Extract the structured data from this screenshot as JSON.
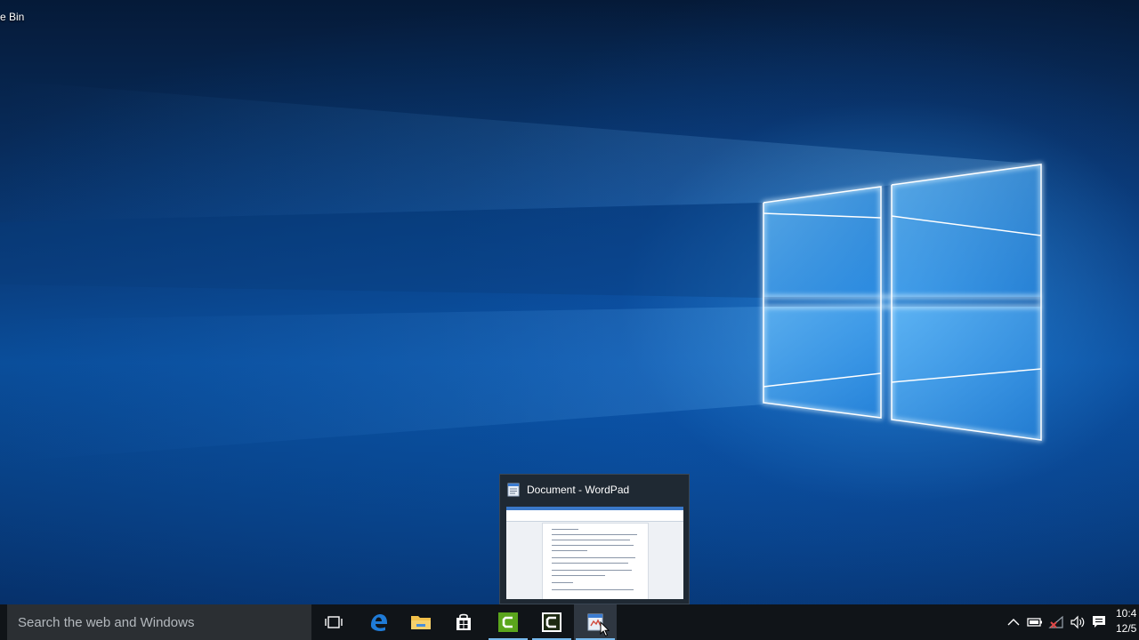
{
  "desktop": {
    "recycle_bin_label": "e Bin"
  },
  "preview": {
    "title": "Document - WordPad"
  },
  "taskbar": {
    "search_placeholder": "Search the web and Windows",
    "pinned": [
      {
        "name": "task-view",
        "icon": "task-view-icon"
      },
      {
        "name": "edge",
        "icon": "edge-icon"
      },
      {
        "name": "file-explorer",
        "icon": "folder-icon"
      },
      {
        "name": "store",
        "icon": "store-icon"
      },
      {
        "name": "camtasia-1",
        "icon": "camtasia-icon"
      },
      {
        "name": "camtasia-2",
        "icon": "camtasia-icon"
      },
      {
        "name": "wordpad",
        "icon": "wordpad-icon"
      }
    ],
    "tray_icons": [
      "chevron-up-icon",
      "battery-icon",
      "network-icon",
      "volume-icon",
      "action-center-icon"
    ],
    "clock_time": "10:4",
    "clock_date": "12/5"
  },
  "colors": {
    "taskbar_bg": "#101418",
    "search_bg": "#2b2f33",
    "active_indicator": "#76b9ed",
    "camtasia_green": "#5aa51c",
    "edge_blue": "#1f7bd7"
  }
}
